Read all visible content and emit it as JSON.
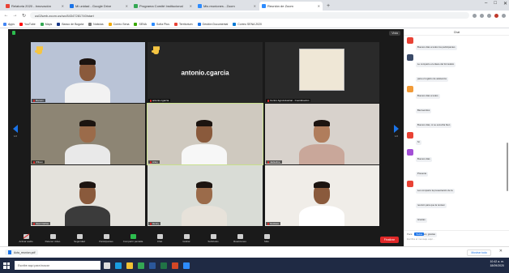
{
  "browser": {
    "tabs": [
      {
        "label": "Relatoria 2020 - Innovación",
        "color": "#e94235",
        "active": false
      },
      {
        "label": "Mi unidad - Google Drive",
        "color": "#1a73e8",
        "active": false
      },
      {
        "label": "Programa Comité Institucional",
        "color": "#34a853",
        "active": false
      },
      {
        "label": "Mis reuniones - Zoom",
        "color": "#2d8cff",
        "active": false
      },
      {
        "label": "Reunión de Zoom",
        "color": "#2d8cff",
        "active": true
      }
    ],
    "new_tab": "+",
    "window_controls": [
      "–",
      "□",
      "✕"
    ],
    "url": "us02web.zoom.us/wc/84347281740/start",
    "bookmarks": [
      {
        "label": "Apps",
        "color": "#4285f4"
      },
      {
        "label": "YouTube",
        "color": "#ff0000"
      },
      {
        "label": "Maps",
        "color": "#34a853"
      },
      {
        "label": "Banco de Bogotá",
        "color": "#1a3a8a"
      },
      {
        "label": "Noticias",
        "color": "#777777"
      },
      {
        "label": "Correo Sena",
        "color": "#f2a900"
      },
      {
        "label": "SENA",
        "color": "#39a900"
      },
      {
        "label": "Sofía Plus",
        "color": "#2d8cff"
      },
      {
        "label": "Territorium",
        "color": "#e94235"
      },
      {
        "label": "Gestión Documental",
        "color": "#1a73e8"
      },
      {
        "label": "Correo SENA 2020",
        "color": "#0078d4"
      }
    ]
  },
  "meeting": {
    "top_label": "",
    "view_button": "Vista",
    "page_left": "1/2",
    "page_right": "1/2",
    "tiles": [
      {
        "name": "Ramón",
        "hand": true,
        "bg": "#b9c3d6",
        "big_name": "",
        "skin": "#8a5a3c",
        "shirt": "#f2f2f2",
        "speaking": false
      },
      {
        "name": "antonio.cgarcia",
        "hand": true,
        "bg": "#262626",
        "big_name": "antonio.cgarcia",
        "skin": "",
        "shirt": "",
        "speaking": false
      },
      {
        "name": "Centro Agroindustrial - Coordinación",
        "hand": false,
        "bg": "#2a2a2a",
        "big_name": "",
        "skin": "",
        "shirt": "",
        "speaking": false
      },
      {
        "name": "Wilson",
        "hand": false,
        "bg": "#8d8574",
        "big_name": "",
        "skin": "#9b6b4a",
        "shirt": "#e9e9e9",
        "speaking": false
      },
      {
        "name": "Arley",
        "hand": false,
        "bg": "#cfc9bf",
        "big_name": "",
        "skin": "#8a5a3c",
        "shirt": "#f7f7f7",
        "speaking": true
      },
      {
        "name": "Jackeline",
        "hand": false,
        "bg": "#d8d2cc",
        "big_name": "",
        "skin": "#b07d5c",
        "shirt": "#c9a79a",
        "speaking": false
      },
      {
        "name": "Juan Carlos",
        "hand": false,
        "bg": "#e4e2dc",
        "big_name": "",
        "skin": "#8a5a3c",
        "shirt": "#3b3b3b",
        "speaking": false
      },
      {
        "name": "Henry",
        "hand": false,
        "bg": "#d9dcd6",
        "big_name": "",
        "skin": "#9b6b4a",
        "shirt": "#e7e2da",
        "speaking": false
      },
      {
        "name": "Gustavo",
        "hand": false,
        "bg": "#f0ede8",
        "big_name": "",
        "skin": "#8a5a3c",
        "shirt": "#ffffff",
        "speaking": false
      }
    ],
    "toolbar": [
      {
        "label": "Activar audio",
        "icon": "microphone-icon",
        "variant": "mic-off"
      },
      {
        "label": "Detener video",
        "icon": "camera-icon",
        "variant": ""
      },
      {
        "label": "Seguridad",
        "icon": "shield-icon",
        "variant": ""
      },
      {
        "label": "Participantes",
        "icon": "participants-icon",
        "variant": ""
      },
      {
        "label": "Compartir pantalla",
        "icon": "share-screen-icon",
        "variant": "green"
      },
      {
        "label": "Chat",
        "icon": "chat-icon",
        "variant": ""
      },
      {
        "label": "Grabar",
        "icon": "record-icon",
        "variant": ""
      },
      {
        "label": "Subtítulos",
        "icon": "captions-icon",
        "variant": ""
      },
      {
        "label": "Reacciones",
        "icon": "reactions-icon",
        "variant": ""
      },
      {
        "label": "Más",
        "icon": "more-icon",
        "variant": ""
      }
    ],
    "end_button": "Finalizar"
  },
  "chat": {
    "title": "Chat",
    "messages": [
      {
        "sender": "",
        "color": "#e94235",
        "lines": [
          "Buenos días a todos los participantes"
        ]
      },
      {
        "sender": "",
        "color": "#3a4a68",
        "lines": [
          "Le comparto el enlace del formulario",
          "para el registro de asistencia"
        ]
      },
      {
        "sender": "",
        "color": "#f29b38",
        "lines": [
          "Buenos días a todos",
          "Bienvenidos",
          "Buenos días, sí se escucha bien"
        ]
      },
      {
        "sender": "",
        "color": "#e94235",
        "lines": [
          "Sí"
        ]
      },
      {
        "sender": "",
        "color": "#a44fd6",
        "lines": [
          "Buenos días",
          "Presente"
        ]
      },
      {
        "sender": "",
        "color": "#e94235",
        "lines": [
          "Les comparto la presentación de la",
          "reunión para que la revisen",
          "Gracias",
          "Muy bien, gracias"
        ]
      }
    ],
    "to_label": "Para:",
    "to_value": "Todos",
    "input_placeholder": "Escriba el mensaje aquí..."
  },
  "downloads": {
    "file": "Acta_reunion.pdf",
    "show_all": "Mostrar todo",
    "close": "✕"
  },
  "taskbar": {
    "search_placeholder": "Escribe aquí para buscar",
    "time": "10:42 a. m.",
    "date": "18/09/2020",
    "icons": [
      {
        "name": "task-view-icon",
        "color": "#dddddd"
      },
      {
        "name": "edge-icon",
        "color": "#1a9de0"
      },
      {
        "name": "file-explorer-icon",
        "color": "#f2c233"
      },
      {
        "name": "chrome-icon",
        "color": "#34a853"
      },
      {
        "name": "word-icon",
        "color": "#2b579a"
      },
      {
        "name": "excel-icon",
        "color": "#217346"
      },
      {
        "name": "powerpoint-icon",
        "color": "#d24726"
      },
      {
        "name": "zoom-icon",
        "color": "#2d8cff"
      }
    ]
  }
}
